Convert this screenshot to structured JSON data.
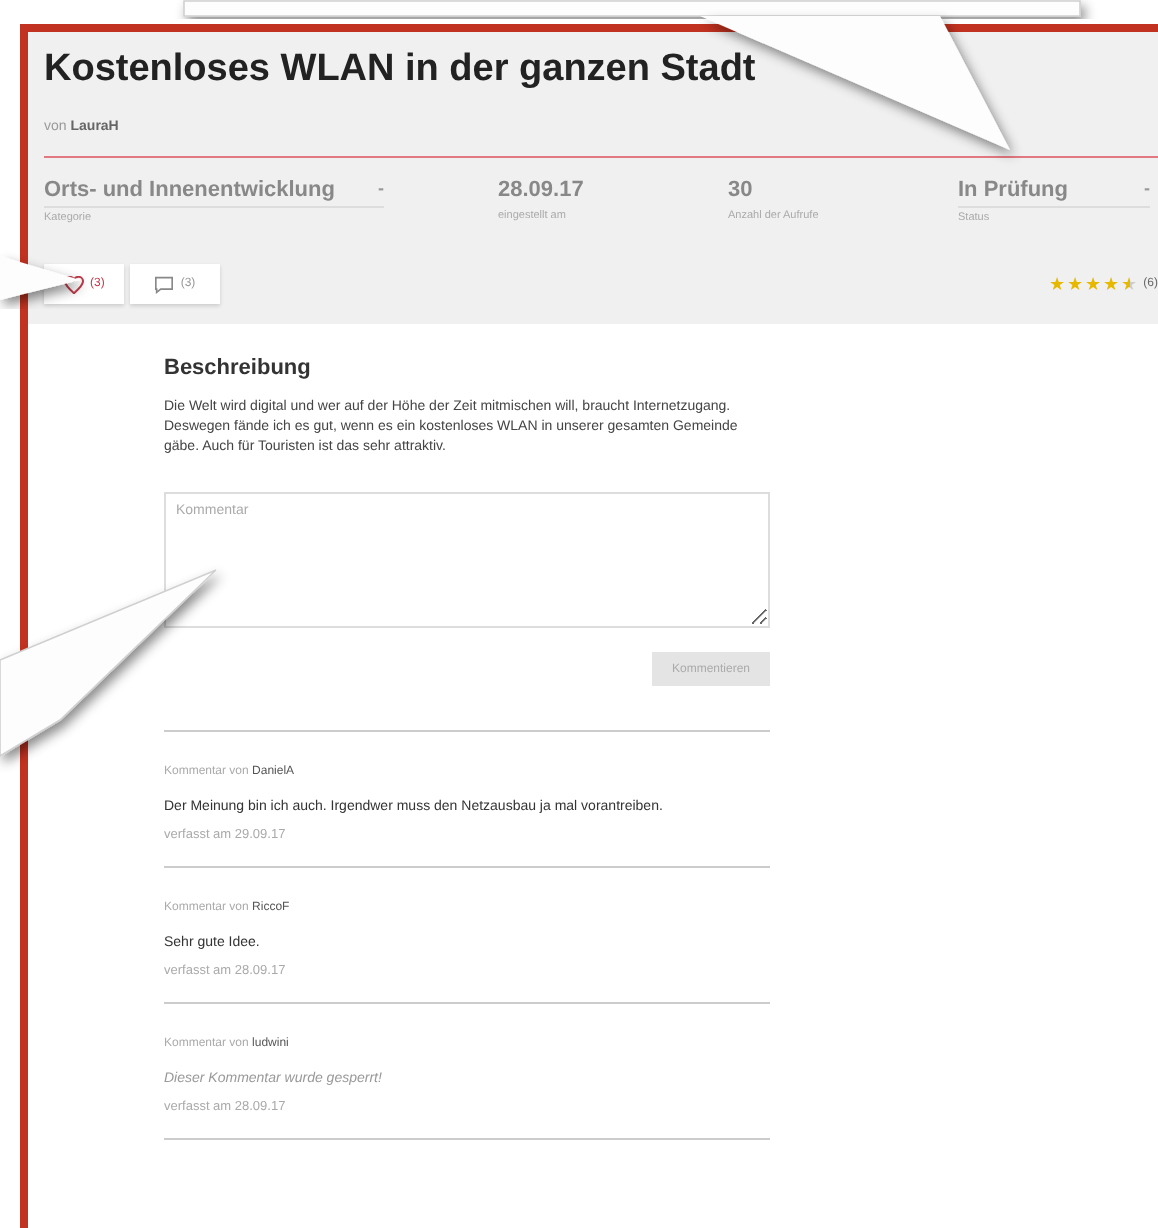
{
  "title": "Kostenloses WLAN in der ganzen Stadt",
  "author": {
    "prefix": "von",
    "name": "LauraH"
  },
  "meta": [
    {
      "kind": "select",
      "value": "Orts- und Innenentwicklung",
      "caret": "-",
      "label": "Kategorie"
    },
    {
      "kind": "plain",
      "value": "28.09.17",
      "label": "eingestellt am"
    },
    {
      "kind": "plain",
      "value": "30",
      "label": "Anzahl der Aufrufe"
    },
    {
      "kind": "select",
      "value": "In Prüfung",
      "caret": "-",
      "label": "Status"
    }
  ],
  "actions": [
    {
      "kind": "like",
      "count": "(3)"
    },
    {
      "kind": "comment",
      "count": "(3)"
    }
  ],
  "rating": {
    "stars": 4.5,
    "count": "(6)"
  },
  "description": {
    "heading": "Beschreibung",
    "text": "Die Welt wird digital und wer auf der Höhe der Zeit mitmischen will, braucht Internetzugang. Deswegen fände ich es gut, wenn es ein kostenloses WLAN in unserer gesamten Gemeinde gäbe. Auch für Touristen ist das sehr attraktiv."
  },
  "comment_form": {
    "placeholder": "Kommentar",
    "button": "Kommentieren",
    "disabled": true
  },
  "comments": [
    {
      "prefix": "Kommentar von",
      "author": "DanielA",
      "text": "Der Meinung bin ich auch. Irgendwer muss den Netzausbau ja mal vorantreiben.",
      "blocked": false,
      "date": "verfasst am 29.09.17"
    },
    {
      "prefix": "Kommentar von",
      "author": "RiccoF",
      "text": "Sehr gute Idee.",
      "blocked": false,
      "date": "verfasst am 28.09.17"
    },
    {
      "prefix": "Kommentar von",
      "author": "ludwini",
      "text": "Dieser Kommentar wurde gesperrt!",
      "blocked": true,
      "date": "verfasst am 28.09.17"
    }
  ]
}
